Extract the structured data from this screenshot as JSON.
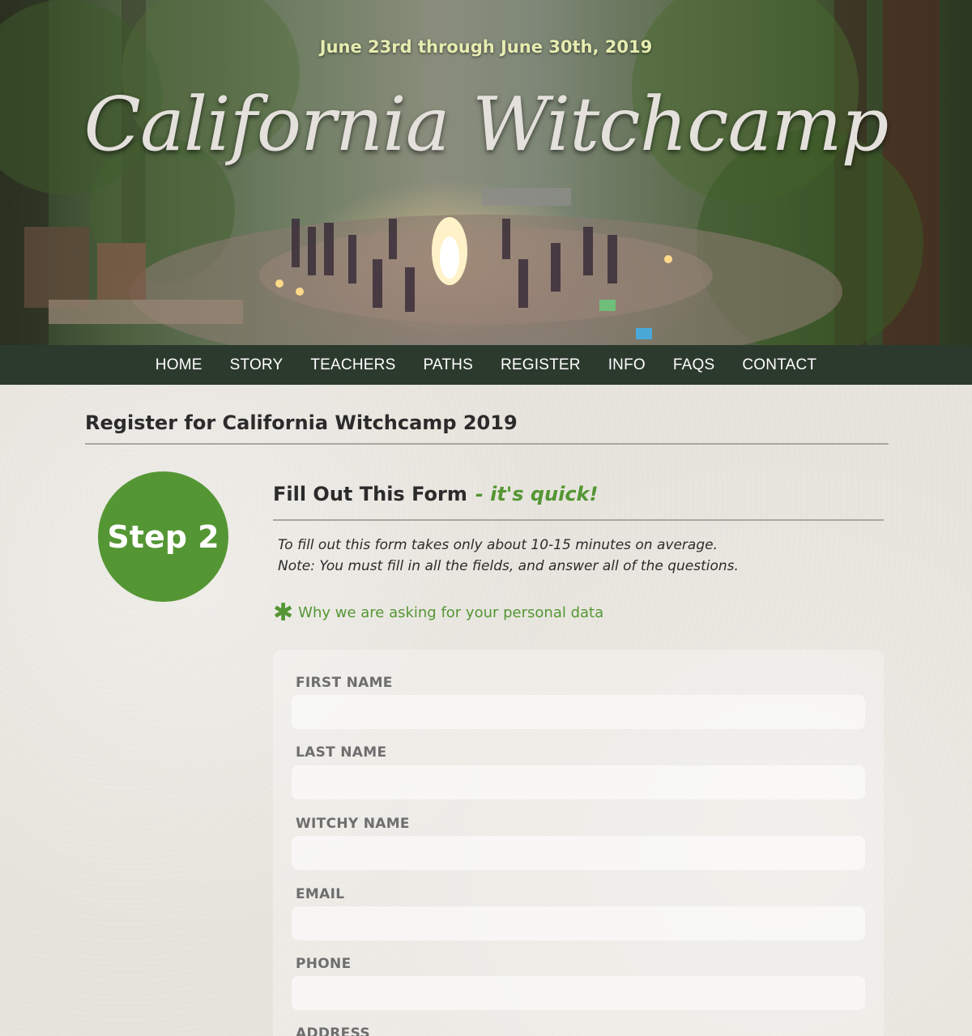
{
  "hero": {
    "date": "June 23rd through June 30th, 2019",
    "title": "California Witchcamp"
  },
  "nav": {
    "items": [
      {
        "label": "HOME"
      },
      {
        "label": "STORY"
      },
      {
        "label": "TEACHERS"
      },
      {
        "label": "PATHS"
      },
      {
        "label": "REGISTER"
      },
      {
        "label": "INFO"
      },
      {
        "label": "FAQS"
      },
      {
        "label": "CONTACT"
      }
    ]
  },
  "main": {
    "title": "Register for California Witchcamp 2019",
    "step_label": "Step 2",
    "section_title": "Fill Out This Form",
    "section_tagline": "- it's quick!",
    "intro_line1": "To fill out this form takes only about 10-15 minutes on average.",
    "intro_line2": "Note: You must fill in all the fields, and answer all of the questions.",
    "why_link": "Why we are asking for your personal data"
  },
  "form": {
    "fields": [
      {
        "label": "FIRST NAME",
        "value": ""
      },
      {
        "label": "LAST NAME",
        "value": ""
      },
      {
        "label": "WITCHY NAME",
        "value": ""
      },
      {
        "label": "EMAIL",
        "value": ""
      },
      {
        "label": "PHONE",
        "value": ""
      },
      {
        "label": "ADDRESS",
        "value": ""
      }
    ]
  },
  "colors": {
    "accent_green": "#549634",
    "nav_bg": "#2c3a2e",
    "page_bg": "#e7e4dd"
  }
}
